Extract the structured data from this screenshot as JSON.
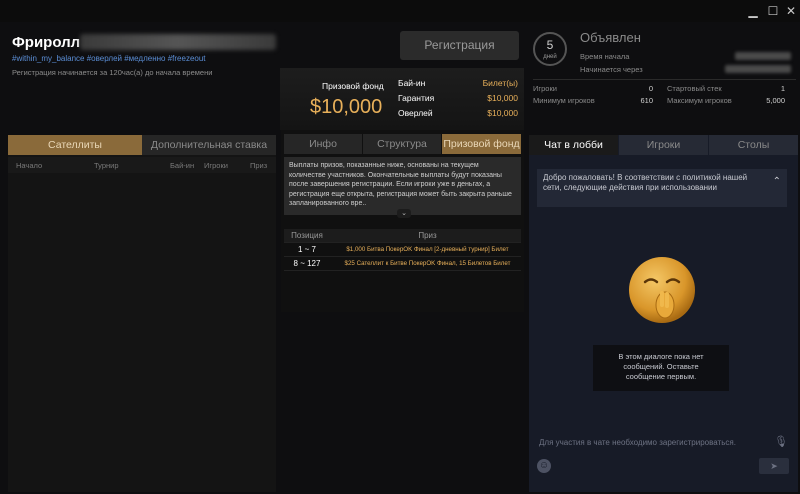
{
  "window": {
    "minimize_icon": "minimize-icon",
    "maximize_icon": "maximize-icon",
    "close_icon": "close-icon"
  },
  "tournament": {
    "title": "Фриролл",
    "tags": "#within_my_balance #оверлей #медленно #freezeout",
    "registration_note": "Регистрация начинается за 120час(а) до начала времени"
  },
  "register_button": "Регистрация",
  "prize_summary": {
    "label": "Призовой фонд",
    "value": "$10,000",
    "rows": [
      {
        "key": "Бай-ин",
        "value": "Билет(ы)"
      },
      {
        "key": "Гарантия",
        "value": "$10,000"
      },
      {
        "key": "Оверлей",
        "value": "$10,000"
      }
    ]
  },
  "status_panel": {
    "countdown_value": "5",
    "countdown_unit": "дней",
    "status": "Объявлен",
    "start_time_label": "Время начала",
    "starts_in_label": "Начинается через",
    "players_label": "Игроки",
    "players_value": "0",
    "min_players_label": "Минимум игроков",
    "min_players_value": "610",
    "start_stack_label": "Стартовый стек",
    "start_stack_value": "1",
    "max_players_label": "Максимум игроков",
    "max_players_value": "5,000"
  },
  "left_tabs": {
    "satellites": "Сателлиты",
    "extra_bet": "Дополнительная ставка"
  },
  "left_columns": {
    "start": "Начало",
    "tournament": "Турнир",
    "buyin": "Бай-ин",
    "players": "Игроки",
    "prize": "Приз"
  },
  "center_tabs": {
    "info": "Инфо",
    "structure": "Структура",
    "prize_pool": "Призовой фонд"
  },
  "prize_description": "Выплаты призов, показанные ниже, основаны на текущем количестве участников. Окончательные выплаты будут показаны после завершения регистрации. Если игроки уже в деньгах, а регистрация еще открыта, регистрация может быть закрыта раньше запланированного вре..",
  "prize_table": {
    "col_position": "Позиция",
    "col_prize": "Приз",
    "rows": [
      {
        "position": "1 ~ 7",
        "prize": "$1,000 Битва ПокерOK Финал [2-дневный турнир] Билет"
      },
      {
        "position": "8 ~ 127",
        "prize": "$25 Сателлит к Битве ПокерOK Финал, 15 Билетов Билет"
      }
    ]
  },
  "chat_tabs": {
    "chat": "Чат в лобби",
    "players": "Игроки",
    "tables": "Столы"
  },
  "chat": {
    "welcome": "Добро пожаловать! В соответствии с политикой нашей сети, следующие действия при использовании",
    "empty_line1": "В этом диалоге пока нет",
    "empty_line2": "сообщений. Оставьте",
    "empty_line3": "сообщение первым.",
    "input_placeholder": "Для участия в чате необходимо зарегистрироваться."
  },
  "colors": {
    "accent_gold": "#e8b05a",
    "active_tab": "#8a6a3a",
    "link_blue": "#5b8ed6",
    "chat_bg": "#171b27"
  }
}
